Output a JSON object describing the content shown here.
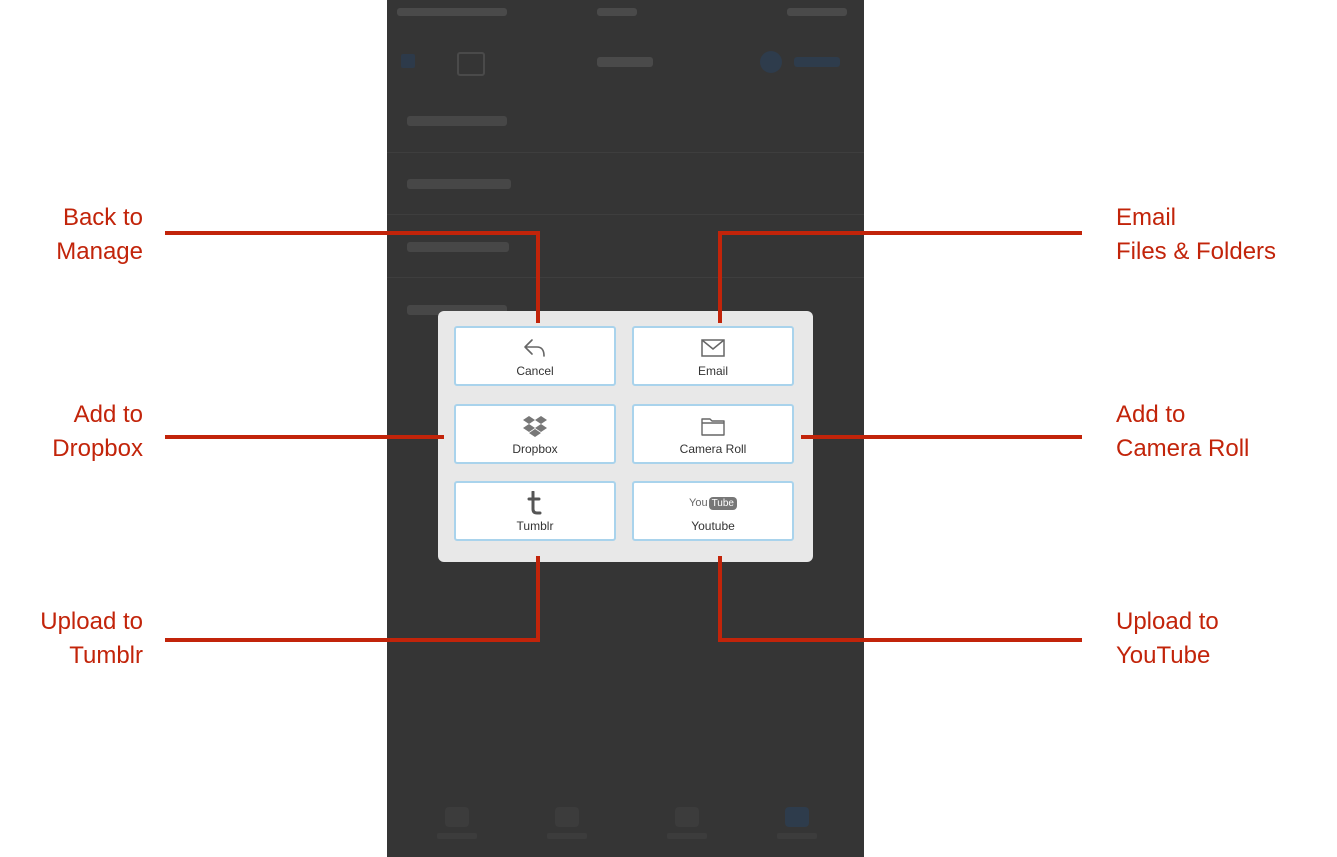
{
  "share_sheet": {
    "cancel_label": "Cancel",
    "email_label": "Email",
    "dropbox_label": "Dropbox",
    "camera_roll_label": "Camera Roll",
    "tumblr_label": "Tumblr",
    "youtube_label": "Youtube",
    "youtube_logo_you": "You",
    "youtube_logo_tube": "Tube"
  },
  "callouts": {
    "back_to_manage": [
      "Back to",
      "Manage"
    ],
    "email_files_folders": [
      "Email",
      "Files & Folders"
    ],
    "add_to_dropbox": [
      "Add to",
      "Dropbox"
    ],
    "add_to_camera_roll": [
      "Add to",
      "Camera Roll"
    ],
    "upload_to_tumblr": [
      "Upload to",
      "Tumblr"
    ],
    "upload_to_youtube": [
      "Upload to",
      "YouTube"
    ]
  },
  "colors": {
    "callout": "#c2240a",
    "tile_border": "#a9d3ec",
    "panel_background": "#e8e8e8",
    "screen_background": "#353535"
  },
  "icons": {
    "cancel": "reply-arrow-icon",
    "email": "envelope-icon",
    "dropbox": "dropbox-icon",
    "camera_roll": "folder-icon",
    "tumblr": "tumblr-icon",
    "youtube": "youtube-logo-icon"
  }
}
